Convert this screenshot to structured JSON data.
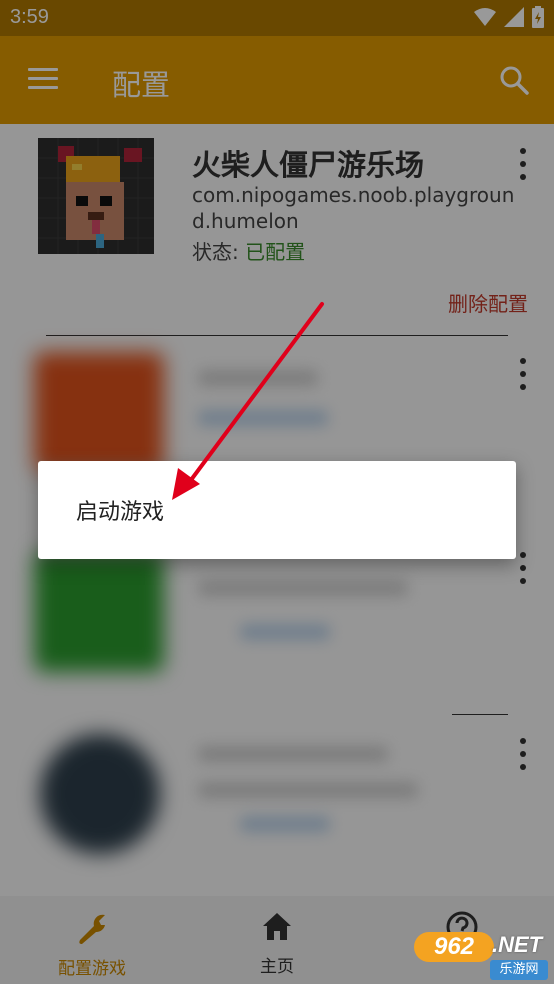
{
  "status_bar": {
    "time": "3:59",
    "icons": [
      "wifi-icon",
      "signal-icon",
      "battery-icon"
    ]
  },
  "app_bar": {
    "title": "配置",
    "left_icon": "menu-icon",
    "right_icon": "search-icon"
  },
  "game_card": {
    "name": "火柴人僵尸游乐场",
    "package": "com.nipogames.noob.playground.humelon",
    "status_label": "状态:",
    "status_value": "已配置",
    "delete_label": "删除配置"
  },
  "popup": {
    "item": "启动游戏"
  },
  "bottom_nav": {
    "items": [
      {
        "label": "配置游戏",
        "icon": "wrench-icon",
        "active": true
      },
      {
        "label": "主页",
        "icon": "home-icon",
        "active": false
      },
      {
        "label": "",
        "icon": "help-icon",
        "active": false
      }
    ]
  },
  "watermark": {
    "number": "962",
    "suffix": ".NET",
    "sub": "乐游网"
  },
  "colors": {
    "app_bar": "#e09a00",
    "status_bar": "#b07800",
    "active_nav": "#c98700",
    "status_ok": "#3a8a2c",
    "delete": "#c0392b",
    "arrow": "#e0001b"
  }
}
